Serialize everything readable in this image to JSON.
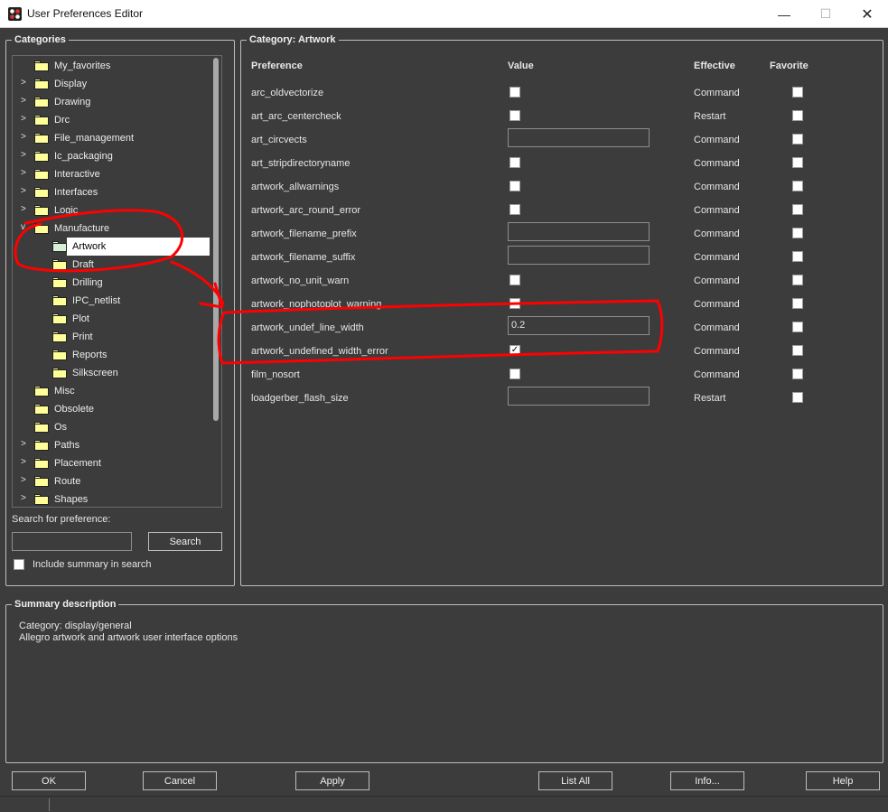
{
  "window": {
    "title": "User Preferences Editor",
    "minimize": "—",
    "maximize": "☐",
    "close": "✕"
  },
  "categories": {
    "title": "Categories",
    "items": [
      {
        "label": "My_favorites",
        "expander": "",
        "depth": 0
      },
      {
        "label": "Display",
        "expander": ">",
        "depth": 0
      },
      {
        "label": "Drawing",
        "expander": ">",
        "depth": 0
      },
      {
        "label": "Drc",
        "expander": ">",
        "depth": 0
      },
      {
        "label": "File_management",
        "expander": ">",
        "depth": 0
      },
      {
        "label": "Ic_packaging",
        "expander": ">",
        "depth": 0
      },
      {
        "label": "Interactive",
        "expander": ">",
        "depth": 0
      },
      {
        "label": "Interfaces",
        "expander": ">",
        "depth": 0
      },
      {
        "label": "Logic",
        "expander": ">",
        "depth": 0
      },
      {
        "label": "Manufacture",
        "expander": "v",
        "depth": 0
      },
      {
        "label": "Artwork",
        "expander": "",
        "depth": 1,
        "selected": true
      },
      {
        "label": "Draft",
        "expander": "",
        "depth": 1
      },
      {
        "label": "Drilling",
        "expander": "",
        "depth": 1
      },
      {
        "label": "IPC_netlist",
        "expander": "",
        "depth": 1
      },
      {
        "label": "Plot",
        "expander": "",
        "depth": 1
      },
      {
        "label": "Print",
        "expander": "",
        "depth": 1
      },
      {
        "label": "Reports",
        "expander": "",
        "depth": 1
      },
      {
        "label": "Silkscreen",
        "expander": "",
        "depth": 1
      },
      {
        "label": "Misc",
        "expander": "",
        "depth": 0
      },
      {
        "label": "Obsolete",
        "expander": "",
        "depth": 0
      },
      {
        "label": "Os",
        "expander": "",
        "depth": 0
      },
      {
        "label": "Paths",
        "expander": ">",
        "depth": 0
      },
      {
        "label": "Placement",
        "expander": ">",
        "depth": 0
      },
      {
        "label": "Route",
        "expander": ">",
        "depth": 0
      },
      {
        "label": "Shapes",
        "expander": ">",
        "depth": 0
      }
    ],
    "search_label": "Search for preference:",
    "search_value": "",
    "search_button": "Search",
    "include_summary_label": "Include summary in search",
    "include_summary_checked": false
  },
  "category_panel": {
    "title": "Category:  Artwork",
    "headers": {
      "preference": "Preference",
      "value": "Value",
      "effective": "Effective",
      "favorite": "Favorite"
    },
    "rows": [
      {
        "name": "arc_oldvectorize",
        "type": "check",
        "checked": false,
        "value": "",
        "effective": "Command"
      },
      {
        "name": "art_arc_centercheck",
        "type": "check",
        "checked": false,
        "value": "",
        "effective": "Restart"
      },
      {
        "name": "art_circvects",
        "type": "text",
        "checked": false,
        "value": "",
        "effective": "Command"
      },
      {
        "name": "art_stripdirectoryname",
        "type": "check",
        "checked": false,
        "value": "",
        "effective": "Command"
      },
      {
        "name": "artwork_allwarnings",
        "type": "check",
        "checked": false,
        "value": "",
        "effective": "Command"
      },
      {
        "name": "artwork_arc_round_error",
        "type": "check",
        "checked": false,
        "value": "",
        "effective": "Command"
      },
      {
        "name": "artwork_filename_prefix",
        "type": "text",
        "checked": false,
        "value": "",
        "effective": "Command"
      },
      {
        "name": "artwork_filename_suffix",
        "type": "text",
        "checked": false,
        "value": "",
        "effective": "Command"
      },
      {
        "name": "artwork_no_unit_warn",
        "type": "check",
        "checked": false,
        "value": "",
        "effective": "Command"
      },
      {
        "name": "artwork_nophotoplot_warning",
        "type": "check",
        "checked": false,
        "value": "",
        "effective": "Command"
      },
      {
        "name": "artwork_undef_line_width",
        "type": "text",
        "checked": false,
        "value": "0.2",
        "effective": "Command"
      },
      {
        "name": "artwork_undefined_width_error",
        "type": "check",
        "checked": true,
        "value": "",
        "effective": "Command"
      },
      {
        "name": "film_nosort",
        "type": "check",
        "checked": false,
        "value": "",
        "effective": "Command"
      },
      {
        "name": "loadgerber_flash_size",
        "type": "text",
        "checked": false,
        "value": "",
        "effective": "Restart"
      }
    ],
    "checkmark": "✓"
  },
  "summary": {
    "title": "Summary description",
    "line1": "Category: display/general",
    "line2": "Allegro artwork and artwork user interface options"
  },
  "buttons": {
    "ok": "OK",
    "cancel": "Cancel",
    "apply": "Apply",
    "list_all": "List All",
    "info": "Info...",
    "help": "Help"
  },
  "colors": {
    "background": "#3c3c3c",
    "folder": "#ffff99",
    "annotation": "#ff0000"
  }
}
